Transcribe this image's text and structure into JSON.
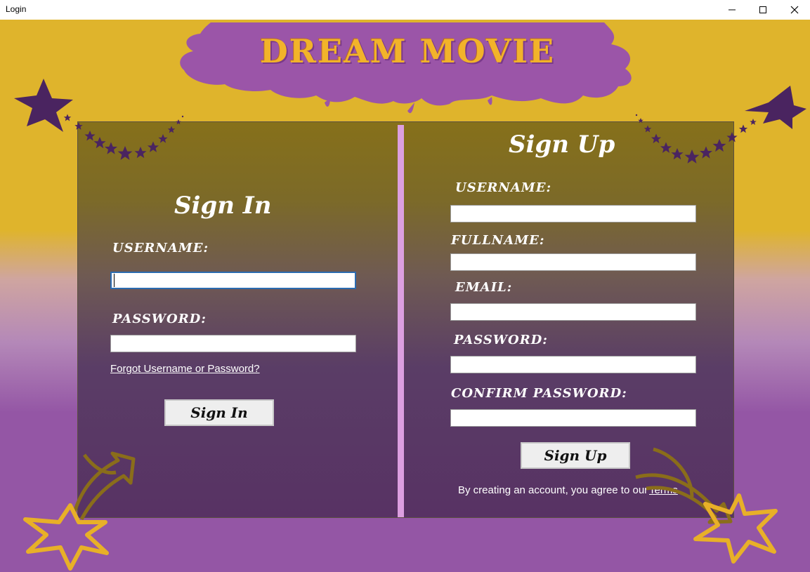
{
  "window": {
    "title": "Login",
    "minimize_icon": "minimize-icon",
    "maximize_icon": "maximize-icon",
    "close_icon": "close-icon"
  },
  "banner": {
    "title": "DREAM MOVIE"
  },
  "colors": {
    "gold": "#dfb42c",
    "purple": "#9456a5",
    "banner_purple": "#9b55a8",
    "divider": "#dc9fe0",
    "star_dark": "#4a2460",
    "arrow_gold": "#8a6d1a"
  },
  "sign_in": {
    "heading": "Sign In",
    "username_label": "USERNAME:",
    "username_value": "",
    "password_label": "PASSWORD:",
    "password_value": "",
    "forgot_link": "Forgot Username or Password?",
    "button": "Sign In"
  },
  "sign_up": {
    "heading": "Sign Up",
    "username_label": "USERNAME:",
    "username_value": "",
    "fullname_label": "FULLNAME:",
    "fullname_value": "",
    "email_label": "EMAIL:",
    "email_value": "",
    "password_label": "PASSWORD:",
    "password_value": "",
    "confirm_label": "CONFIRM PASSWORD:",
    "confirm_value": "",
    "button": "Sign Up",
    "terms_text": "By creating an account, you agree to our",
    "terms_link": "Terms"
  }
}
